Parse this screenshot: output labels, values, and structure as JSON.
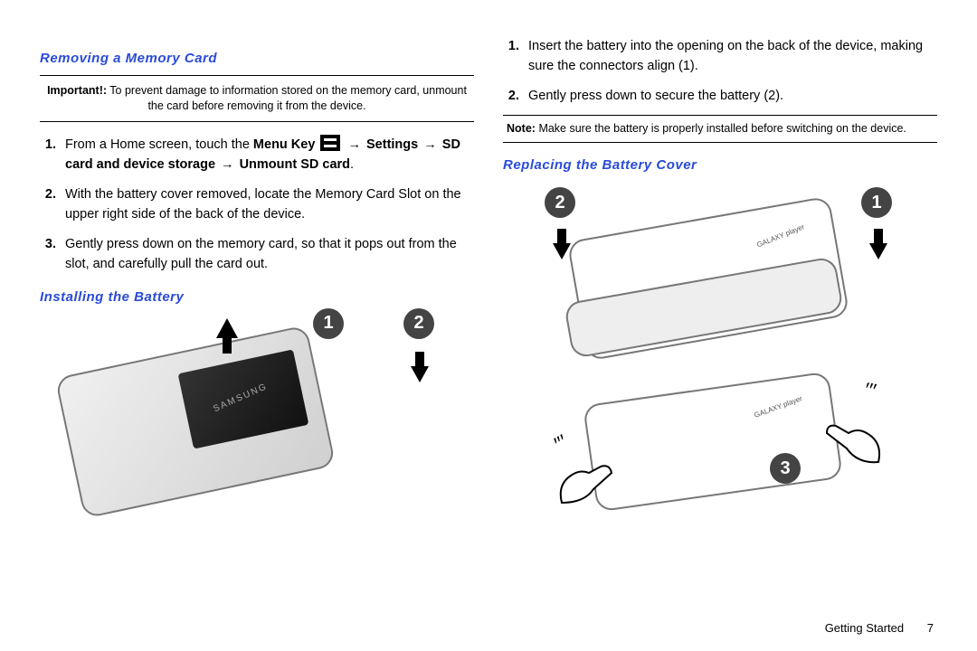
{
  "left": {
    "heading1": "Removing a Memory Card",
    "important": {
      "label": "Important!:",
      "text": "To prevent damage to information stored on the memory card, unmount the card before removing it from the device."
    },
    "steps1": [
      {
        "n": "1.",
        "pre": "From a Home screen, touch the ",
        "menuKey": "Menu Key",
        "arrow1": "→",
        "settings": "Settings",
        "arrow2": "→",
        "sd": "SD card and device storage",
        "arrow3": "→",
        "unmount": "Unmount SD card",
        "post": "."
      },
      {
        "n": "2.",
        "text": "With the battery cover removed, locate the Memory Card Slot on the upper right side of the back of the device."
      },
      {
        "n": "3.",
        "text": "Gently press down on the memory card, so that it pops out from the slot, and carefully pull the card out."
      }
    ],
    "heading2": "Installing the Battery"
  },
  "right": {
    "stepsTop": [
      {
        "n": "1.",
        "text": "Insert the battery into the opening on the back of the device, making sure the connectors align (1)."
      },
      {
        "n": "2.",
        "text": "Gently press down to secure the battery (2)."
      }
    ],
    "note": {
      "label": "Note:",
      "text": "Make sure the battery is properly installed before switching on the device."
    },
    "heading": "Replacing the Battery Cover"
  },
  "footer": {
    "section": "Getting Started",
    "page": "7"
  },
  "illustrations": {
    "leftPhone": "SAMSUNG",
    "rightTop": "GALAXY player",
    "rightBottom": "GALAXY player"
  }
}
